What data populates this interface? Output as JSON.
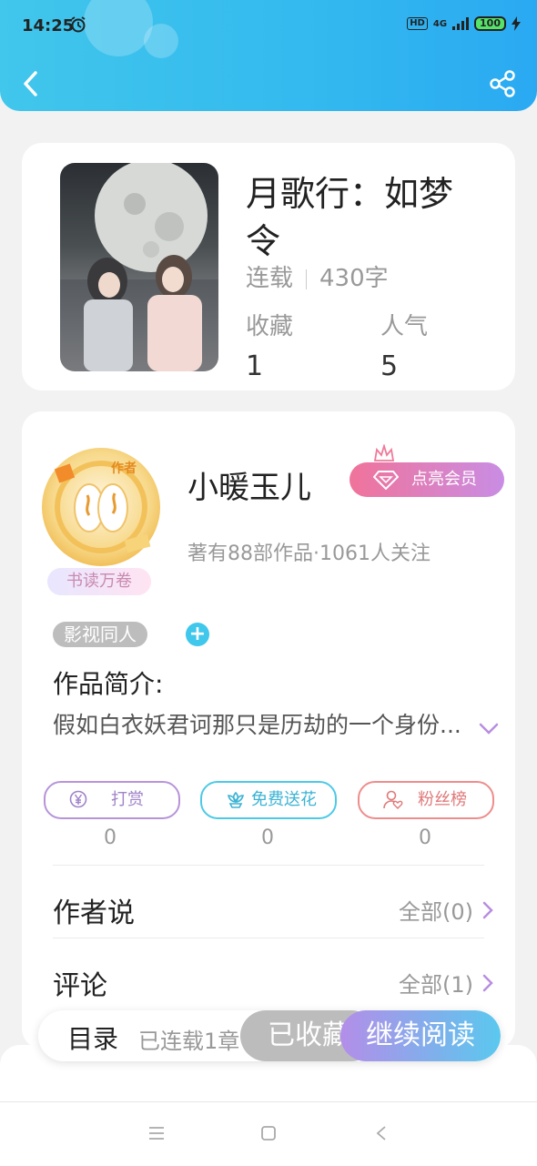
{
  "status_bar": {
    "time": "14:25",
    "hd": "HD",
    "network": "4G",
    "battery": "100"
  },
  "book": {
    "title": "月歌行：如梦令",
    "status": "连载",
    "word_count": "430字",
    "favorites_label": "收藏",
    "favorites_value": "1",
    "popularity_label": "人气",
    "popularity_value": "5"
  },
  "author": {
    "name": "小暖玉儿",
    "vip_button": "点亮会员",
    "stats": "著有88部作品·1061人关注",
    "avatar_badge": "书读万卷",
    "avatar_corner": "作者"
  },
  "tags": {
    "genre": "影视同人",
    "add_icon": "plus-icon"
  },
  "intro": {
    "title": "作品简介:",
    "text": "假如白衣妖君诃那只是历劫的一个身份..."
  },
  "actions": {
    "reward_label": "打赏",
    "reward_count": "0",
    "flower_label": "免费送花",
    "flower_count": "0",
    "fans_label": "粉丝榜",
    "fans_count": "0"
  },
  "sections": {
    "author_says_title": "作者说",
    "author_says_more": "全部(0)",
    "comments_title": "评论",
    "comments_more": "全部(1)"
  },
  "bottom_bar": {
    "catalog": "目录",
    "chapters": "已连载1章",
    "collected": "已收藏",
    "continue_reading": "继续阅读"
  },
  "colors": {
    "header_accent": "#33b9ee",
    "vip_gradient_start": "#f0739a",
    "vip_gradient_end": "#c98de4",
    "read_button_gradient_start": "#b38ee8",
    "read_button_gradient_end": "#5ac8ef"
  }
}
